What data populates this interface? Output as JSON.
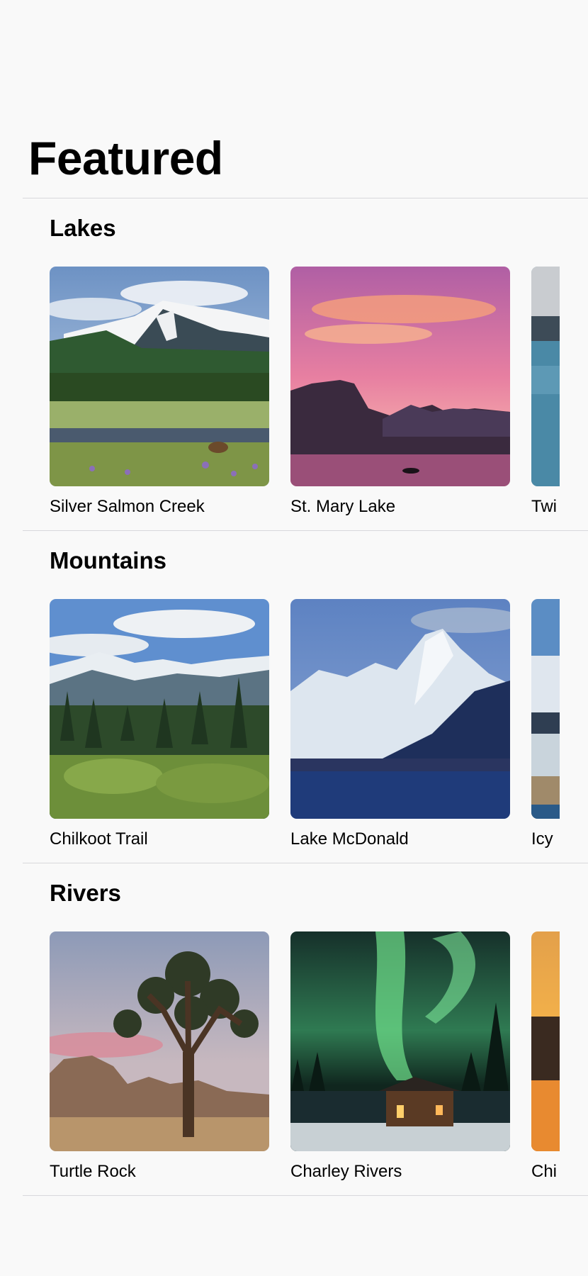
{
  "page": {
    "title": "Featured"
  },
  "sections": [
    {
      "title": "Lakes",
      "items": [
        {
          "name": "Silver Salmon Creek",
          "image": "meadow-mountain-photo"
        },
        {
          "name": "St. Mary Lake",
          "image": "sunset-lake-photo"
        },
        {
          "name": "Twi",
          "image": "twin-lake-photo"
        }
      ]
    },
    {
      "title": "Mountains",
      "items": [
        {
          "name": "Chilkoot Trail",
          "image": "forest-mountain-photo"
        },
        {
          "name": "Lake McDonald",
          "image": "snow-peak-lake-photo"
        },
        {
          "name": "Icy",
          "image": "glacier-photo"
        }
      ]
    },
    {
      "title": "Rivers",
      "items": [
        {
          "name": "Turtle Rock",
          "image": "joshua-tree-photo"
        },
        {
          "name": "Charley Rivers",
          "image": "aurora-cabin-photo"
        },
        {
          "name": "Chi",
          "image": "orange-sunset-photo"
        }
      ]
    }
  ]
}
